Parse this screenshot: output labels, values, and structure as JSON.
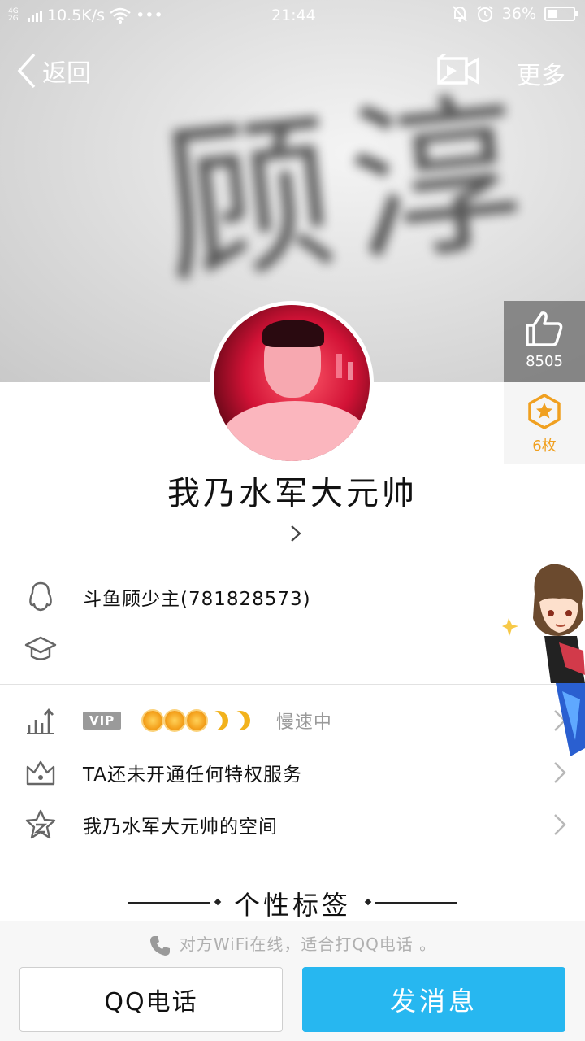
{
  "status_bar": {
    "network": "4G 2G",
    "speed": "10.5K/s",
    "dots": "•••",
    "time": "21:44",
    "battery": "36%",
    "battery_level": 0.36
  },
  "header": {
    "back_label": "返回",
    "more_label": "更多",
    "cover_text": "顾淳"
  },
  "likes": {
    "count": "8505"
  },
  "medals": {
    "count": "6枚"
  },
  "profile": {
    "nickname": "我乃水军大元帅"
  },
  "info": {
    "qq_line": "斗鱼顾少主(781828573)",
    "school_line": ""
  },
  "rows": {
    "vip_label": "VIP",
    "vip_status": "慢速中",
    "privilege": "TA还未开通任何特权服务",
    "space": "我乃水军大元帅的空间"
  },
  "tags_title": "个性标签",
  "bottom": {
    "hint": "对方WiFi在线，适合打QQ电话 。",
    "call_label": "QQ电话",
    "message_label": "发消息"
  },
  "colors": {
    "accent": "#27b7f0",
    "medal": "#f0a020",
    "muted": "#9a9a9a"
  }
}
